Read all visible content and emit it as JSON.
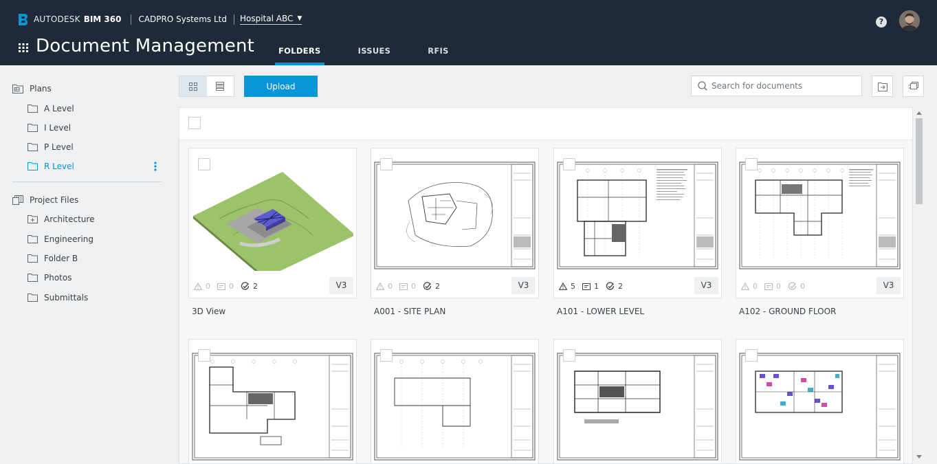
{
  "header": {
    "brand_prefix": "AUTODESK",
    "brand_product": "BIM 360",
    "company": "CADPRO Systems Ltd",
    "project": "Hospital ABC",
    "page_title": "Document Management",
    "tabs": [
      {
        "label": "FOLDERS",
        "active": true
      },
      {
        "label": "ISSUES",
        "active": false
      },
      {
        "label": "RFIS",
        "active": false
      }
    ],
    "help_glyph": "?",
    "accent_color": "#0696d7",
    "bar_color": "#1e2a38"
  },
  "sidebar": {
    "plans_label": "Plans",
    "plans_items": [
      {
        "label": "A Level"
      },
      {
        "label": "I Level"
      },
      {
        "label": "P Level"
      },
      {
        "label": "R Level",
        "active": true
      }
    ],
    "project_files_label": "Project Files",
    "project_files_items": [
      {
        "label": "Architecture"
      },
      {
        "label": "Engineering"
      },
      {
        "label": "Folder B"
      },
      {
        "label": "Photos"
      },
      {
        "label": "Submittals"
      }
    ]
  },
  "toolbar": {
    "upload_label": "Upload",
    "search_placeholder": "Search for documents"
  },
  "documents": [
    {
      "title": "3D View",
      "issues": "0",
      "markups": "0",
      "reviews": "2",
      "version": "V3",
      "active_meta": false
    },
    {
      "title": "A001 - SITE PLAN",
      "issues": "0",
      "markups": "0",
      "reviews": "2",
      "version": "V3",
      "active_meta": false
    },
    {
      "title": "A101 - LOWER LEVEL",
      "issues": "5",
      "markups": "1",
      "reviews": "2",
      "version": "V3",
      "active_meta": true
    },
    {
      "title": "A102 - GROUND FLOOR",
      "issues": "0",
      "markups": "0",
      "reviews": "0",
      "version": "V3",
      "active_meta": false
    }
  ]
}
